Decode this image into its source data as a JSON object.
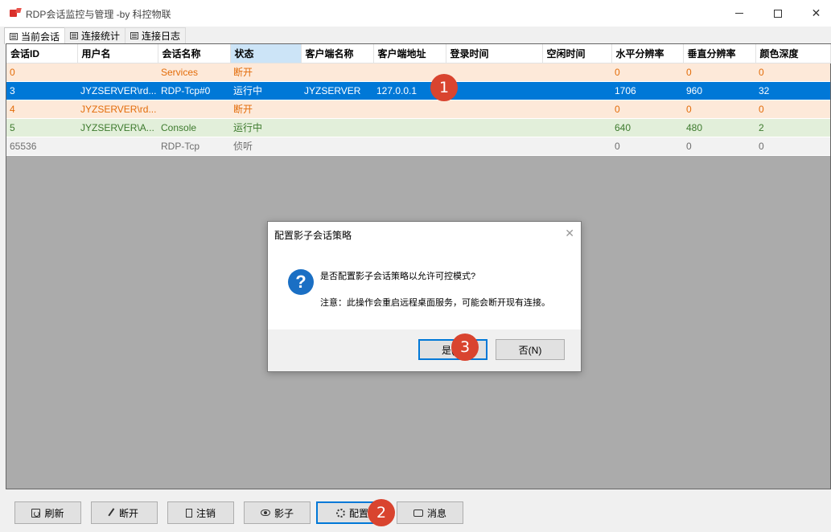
{
  "window": {
    "title": "RDP会话监控与管理 -by 科控物联",
    "controls": {
      "minimize": "minimize-icon",
      "maximize": "maximize-icon",
      "close": "✕"
    }
  },
  "tabs": [
    {
      "label": "当前会话",
      "icon": "session-icon"
    },
    {
      "label": "连接统计",
      "icon": "chart-icon"
    },
    {
      "label": "连接日志",
      "icon": "log-icon"
    }
  ],
  "table": {
    "columns": [
      "会话ID",
      "用户名",
      "会话名称",
      "状态",
      "客户端名称",
      "客户端地址",
      "登录时间",
      "空闲时间",
      "水平分辨率",
      "垂直分辨率",
      "颜色深度"
    ],
    "rows": [
      [
        "0",
        "",
        "Services",
        "断开",
        "",
        "",
        "",
        "",
        "0",
        "0",
        "0"
      ],
      [
        "3",
        "JYZSERVER\\rd...",
        "RDP-Tcp#0",
        "运行中",
        "JYZSERVER",
        "127.0.0.1",
        "",
        "",
        "1706",
        "960",
        "32"
      ],
      [
        "4",
        "JYZSERVER\\rd...",
        "",
        "断开",
        "",
        "",
        "",
        "",
        "0",
        "0",
        "0"
      ],
      [
        "5",
        "JYZSERVER\\A...",
        "Console",
        "运行中",
        "",
        "",
        "",
        "",
        "640",
        "480",
        "2"
      ],
      [
        "65536",
        "",
        "RDP-Tcp",
        "侦听",
        "",
        "",
        "",
        "",
        "0",
        "0",
        "0"
      ]
    ],
    "colors": {
      "disconnected": "#e36c09",
      "selected": "#0078d7",
      "running": "#3d7a2d",
      "listening": "#6d6d6d"
    }
  },
  "dialog": {
    "title": "配置影子会话策略",
    "close": "✕",
    "icon": "question-icon",
    "icon_glyph": "?",
    "question": "是否配置影子会话策略以允许可控模式?",
    "note": "注意：此操作会重启远程桌面服务，可能会断开现有连接。",
    "yes_label": "是(Y)",
    "no_label": "否(N)"
  },
  "toolbar": {
    "refresh": "刷新",
    "disconnect": "断开",
    "logoff": "注销",
    "shadow": "影子",
    "config": "配置",
    "message": "消息"
  },
  "annotations": [
    "1",
    "2",
    "3"
  ],
  "accent_color": "#d9442f"
}
